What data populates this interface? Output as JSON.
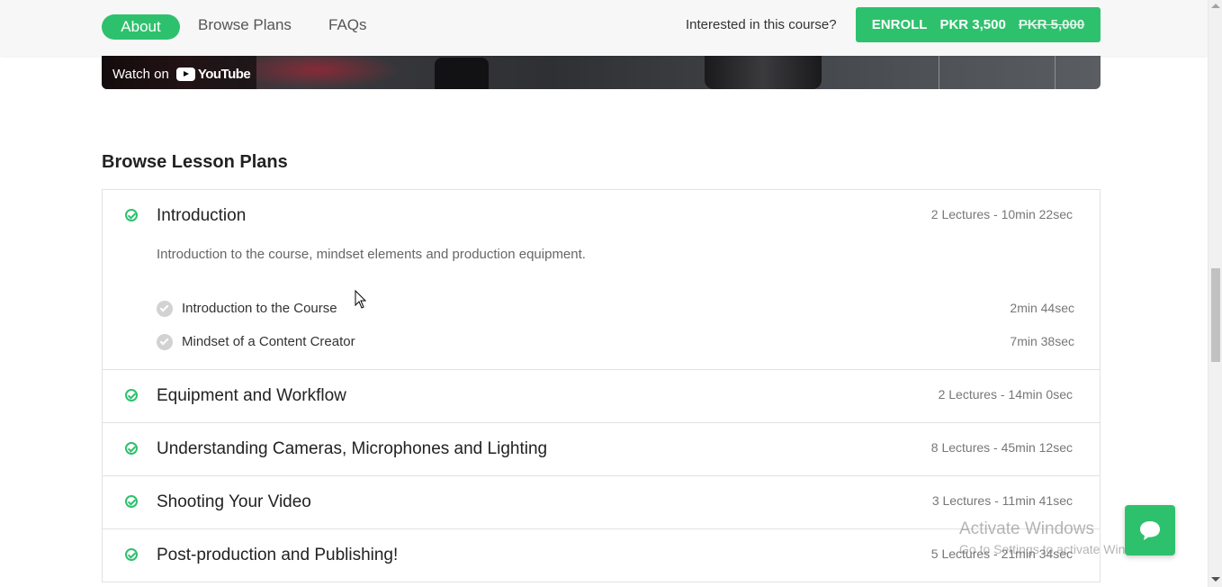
{
  "nav": {
    "about": "About",
    "browse_plans": "Browse Plans",
    "faqs": "FAQs",
    "interested": "Interested in this course?",
    "enroll_label": "ENROLL",
    "price": "PKR 3,500",
    "old_price": "PKR 5,000"
  },
  "video": {
    "watch_on": "Watch on",
    "youtube": "YouTube"
  },
  "section_title": "Browse Lesson Plans",
  "plans": [
    {
      "title": "Introduction",
      "meta": "2 Lectures - 10min 22sec",
      "description": "Introduction to the course, mindset elements and production equipment.",
      "lectures": [
        {
          "title": "Introduction to the Course",
          "time": "2min 44sec"
        },
        {
          "title": "Mindset of a Content Creator",
          "time": "7min 38sec"
        }
      ]
    },
    {
      "title": "Equipment and Workflow",
      "meta": "2 Lectures - 14min 0sec"
    },
    {
      "title": "Understanding Cameras, Microphones and Lighting",
      "meta": "8 Lectures - 45min 12sec"
    },
    {
      "title": "Shooting Your Video",
      "meta": "3 Lectures - 11min 41sec"
    },
    {
      "title": "Post-production and Publishing!",
      "meta": "5 Lectures - 21min 34sec"
    }
  ],
  "watermark": {
    "line1": "Activate Windows",
    "line2": "Go to Settings to activate Windows."
  },
  "colors": {
    "accent": "#2ec16d"
  },
  "icons": {
    "chat": "chat-bubble-icon",
    "check": "check-circle-icon"
  }
}
